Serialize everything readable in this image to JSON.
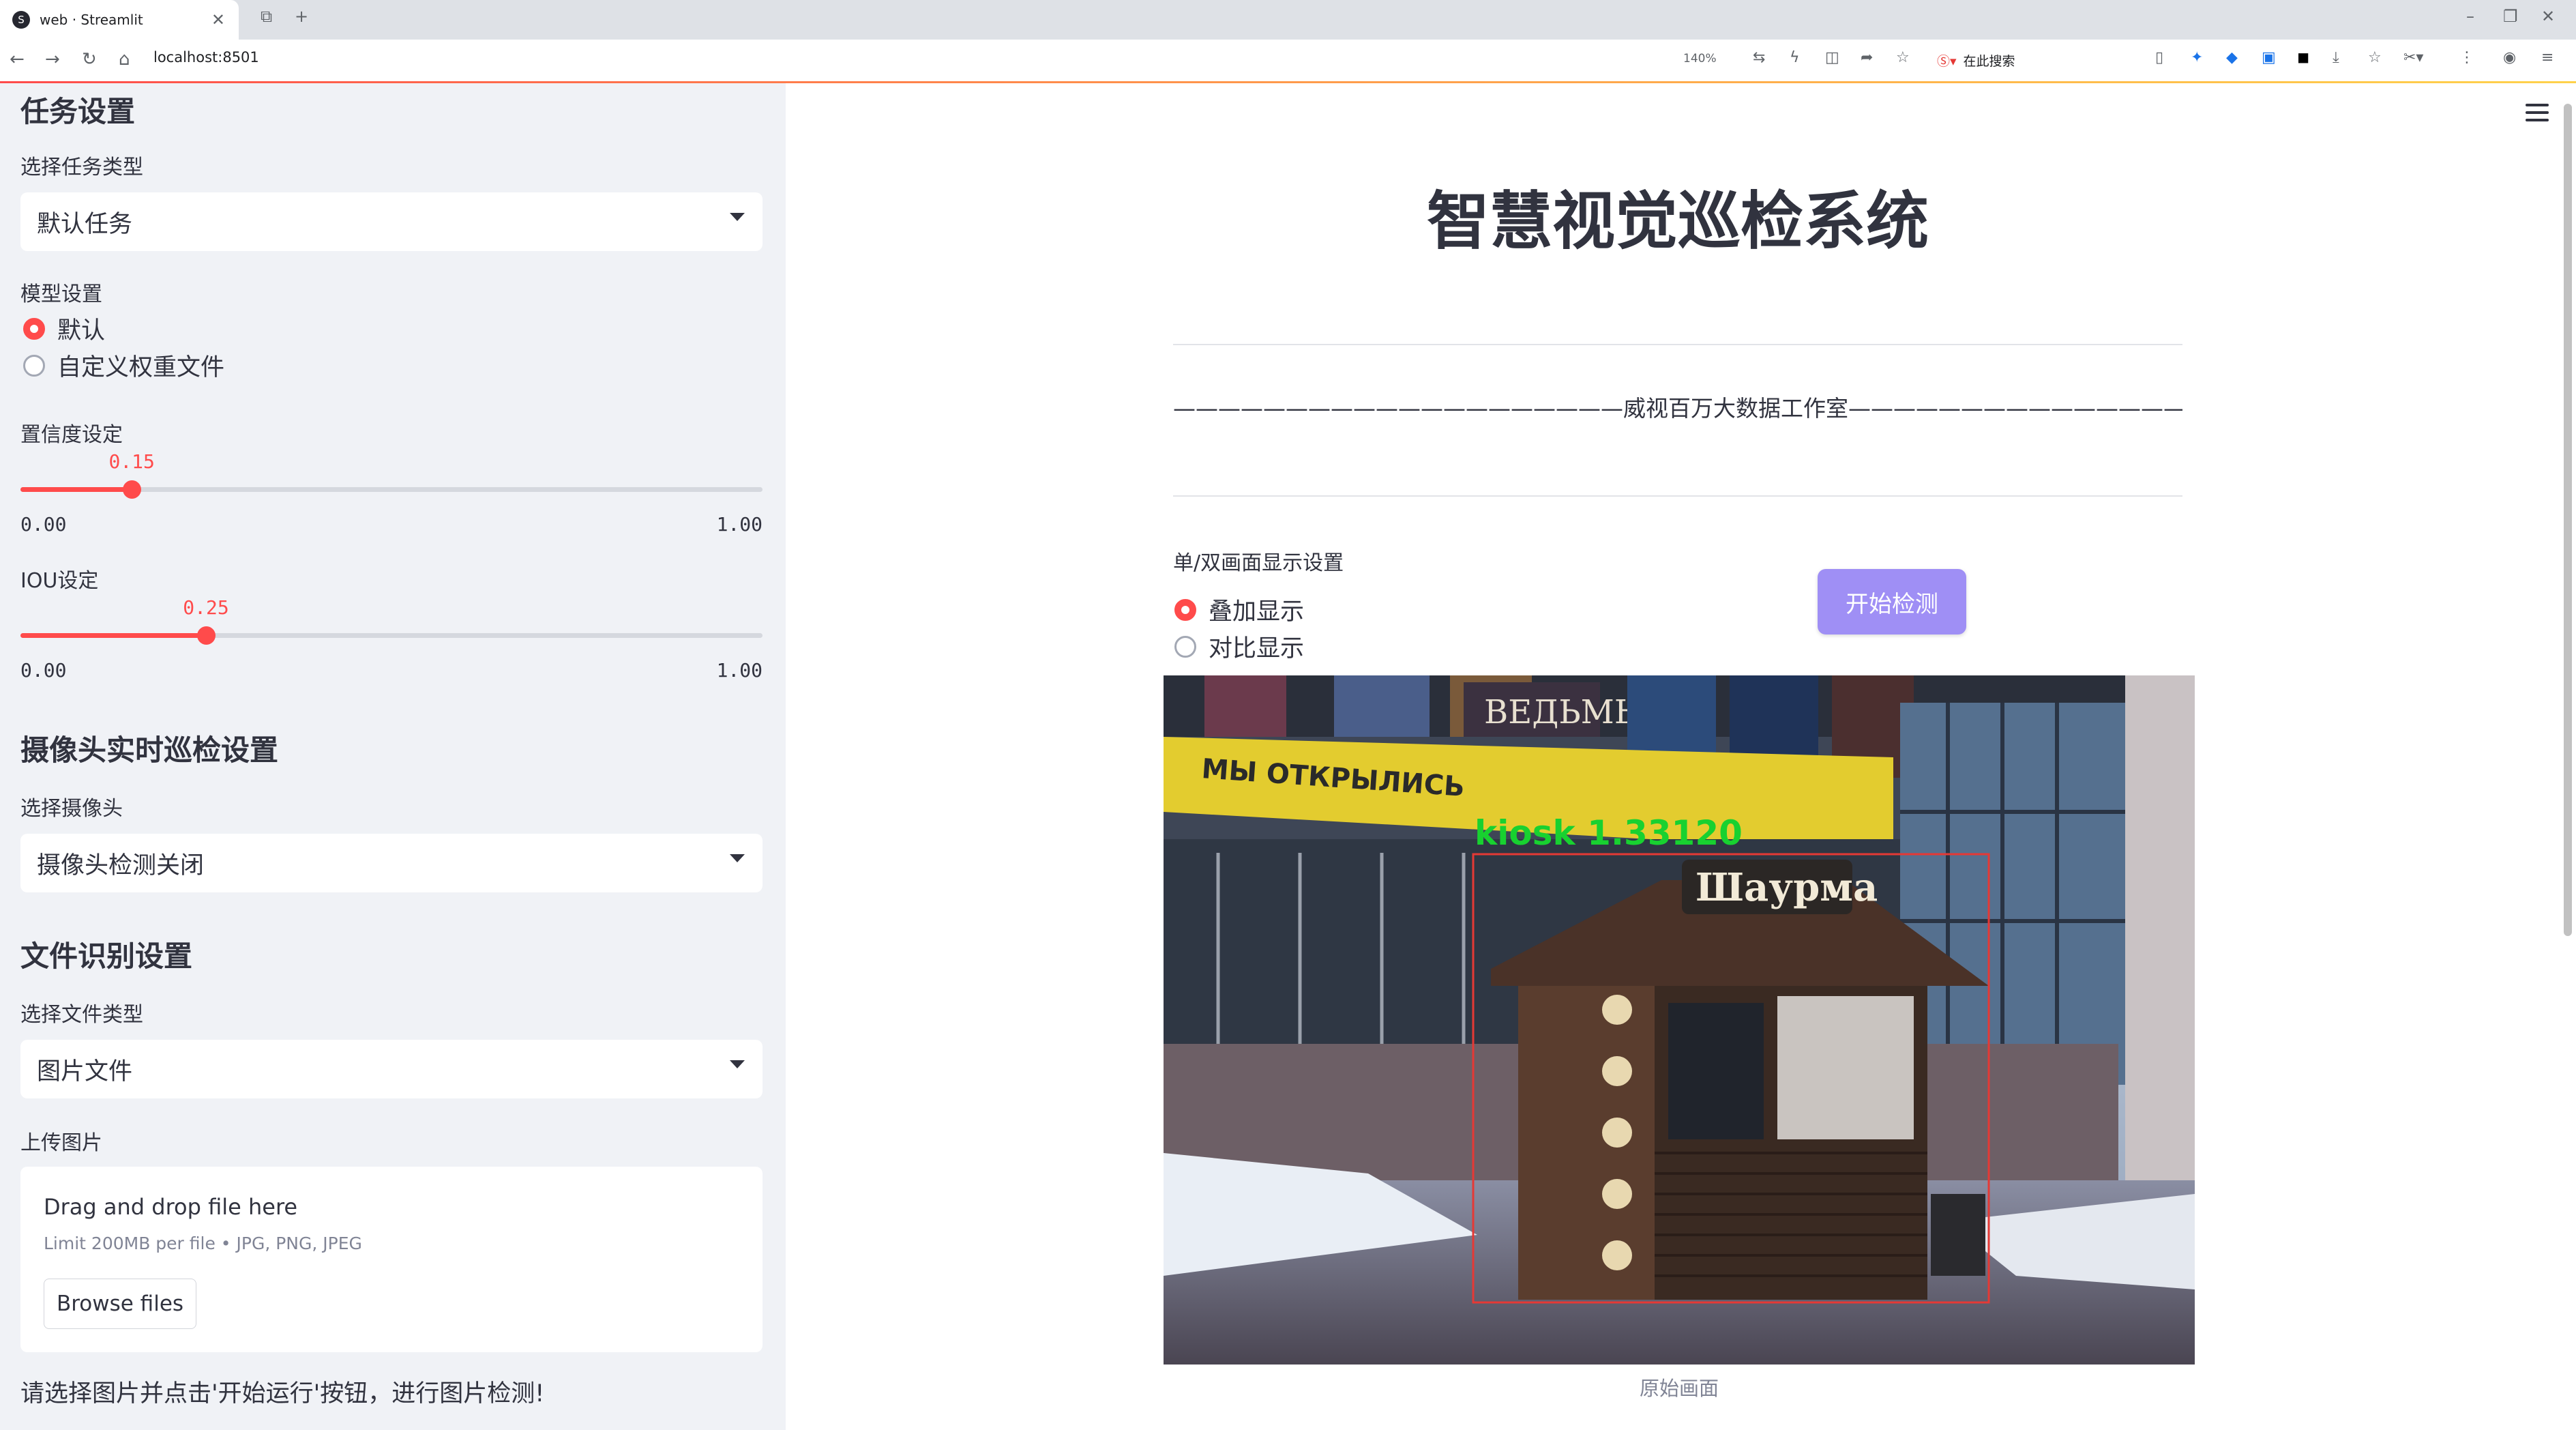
{
  "browser": {
    "tab_title": "web · Streamlit",
    "favicon_text": "S",
    "address": "localhost:8501",
    "zoom": "140%",
    "search_placeholder": "在此搜索"
  },
  "sidebar": {
    "task_heading": "任务设置",
    "task_type_label": "选择任务类型",
    "task_type_value": "默认任务",
    "model_label": "模型设置",
    "model_options": [
      "默认",
      "自定义权重文件"
    ],
    "model_selected": 0,
    "conf_label": "置信度设定",
    "conf": {
      "value": 0.15,
      "display": "0.15",
      "min": "0.00",
      "max": "1.00"
    },
    "iou_label": "IOU设定",
    "iou": {
      "value": 0.25,
      "display": "0.25",
      "min": "0.00",
      "max": "1.00"
    },
    "camera_heading": "摄像头实时巡检设置",
    "camera_label": "选择摄像头",
    "camera_value": "摄像头检测关闭",
    "file_heading": "文件识别设置",
    "file_type_label": "选择文件类型",
    "file_type_value": "图片文件",
    "upload_label": "上传图片",
    "upload_title": "Drag and drop file here",
    "upload_sub": "Limit 200MB per file • JPG, PNG, JPEG",
    "browse_label": "Browse files",
    "hint": "请选择图片并点击'开始运行'按钮，进行图片检测!"
  },
  "main": {
    "title": "智慧视觉巡检系统",
    "studio": "————————————————————威视百万大数据工作室——————————————————————",
    "display_label": "单/双画面显示设置",
    "display_options": [
      "叠加显示",
      "对比显示"
    ],
    "display_selected": 0,
    "start_button": "开始检测",
    "detection_label": "kiosk  1.33120",
    "sign_text": "МЫ ОТКРЫЛИСЬ",
    "kiosk_sign": "Шаурма",
    "poster_text": "ВЕДЬМЫ",
    "caption": "原始画面"
  },
  "colors": {
    "accent": "#ff4b4b",
    "button": "#9f8ff5",
    "detection_box": "#e53935",
    "detection_text": "#18d130"
  }
}
